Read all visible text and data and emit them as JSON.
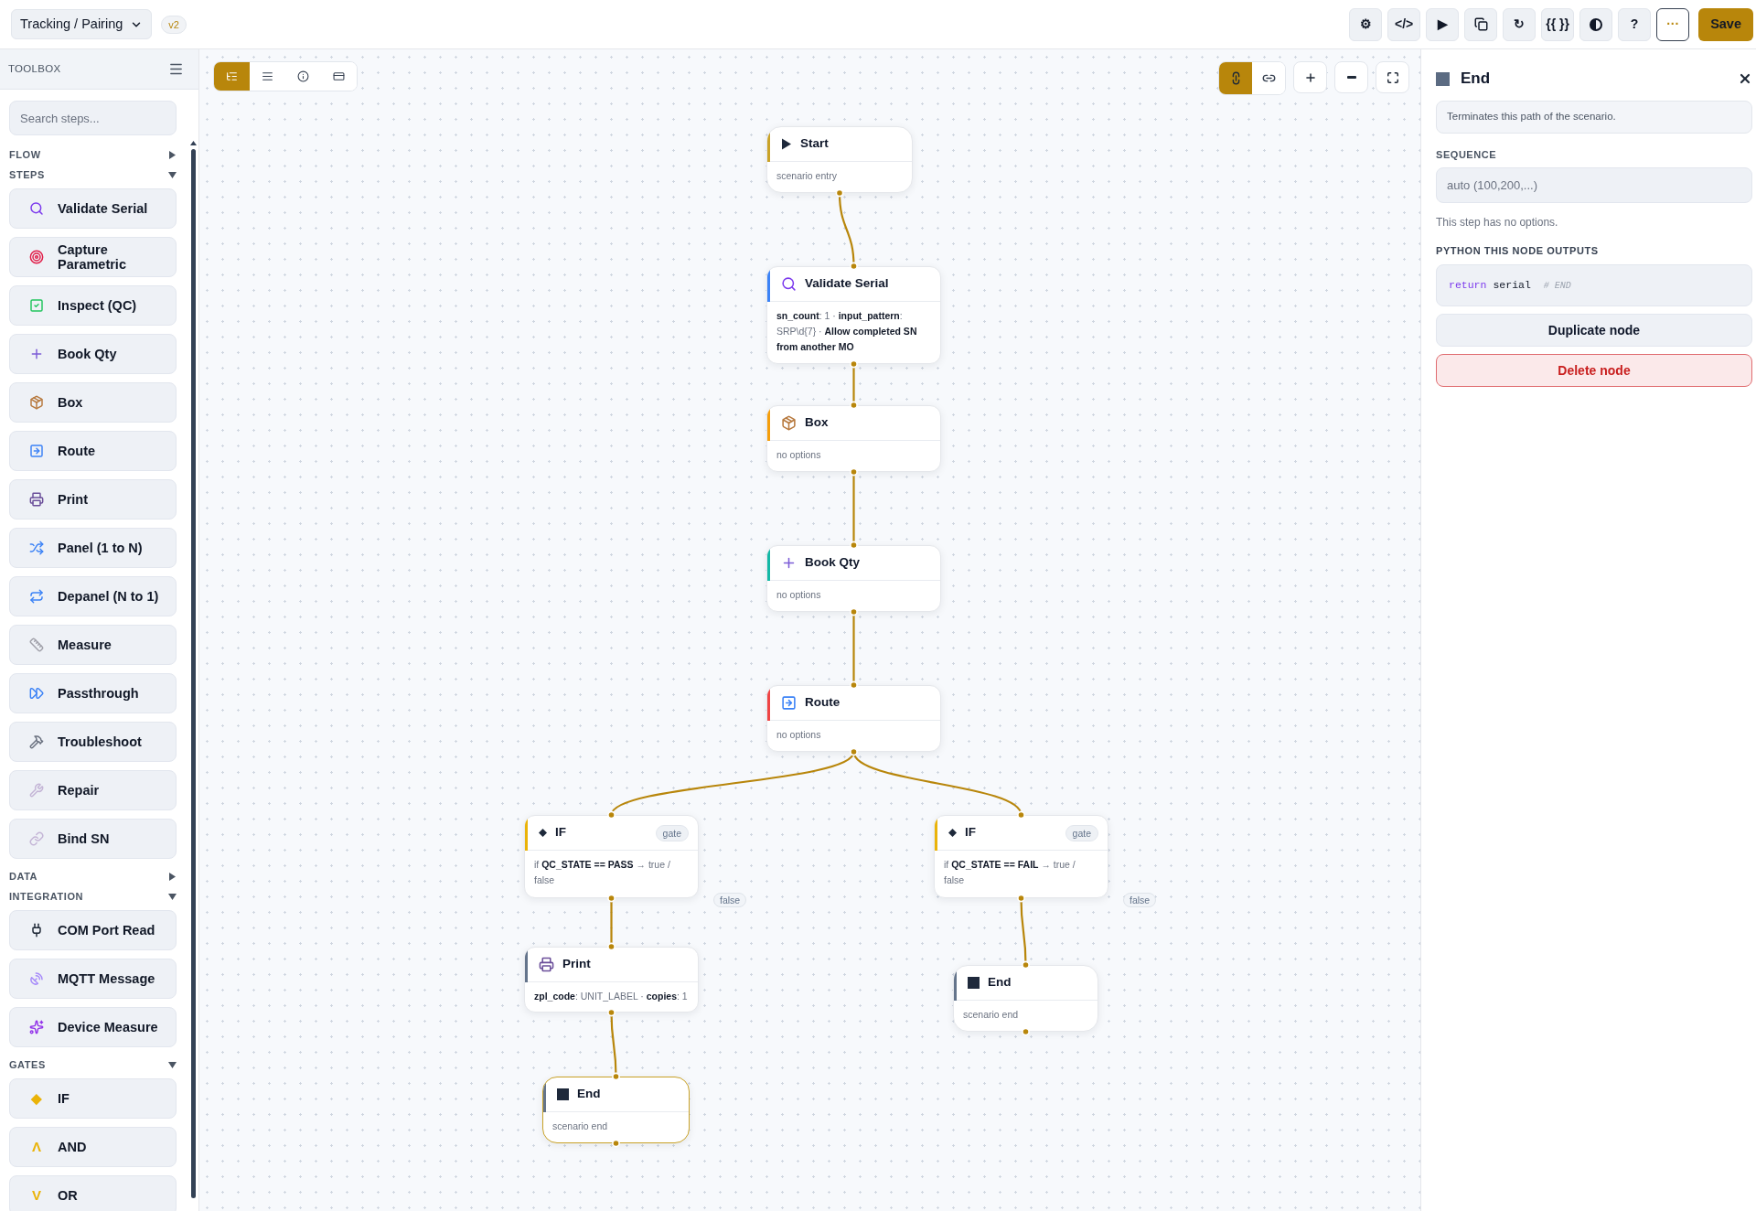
{
  "header": {
    "title": "Tracking / Pairing",
    "version": "v2",
    "tools": [
      {
        "kind": "text",
        "label": "⚙"
      },
      {
        "kind": "text",
        "label": "</>"
      },
      {
        "kind": "text",
        "label": "▶"
      },
      {
        "kind": "copy"
      },
      {
        "kind": "text",
        "label": "↻"
      },
      {
        "kind": "text",
        "label": "{{ }}"
      },
      {
        "kind": "contrast"
      },
      {
        "kind": "text",
        "label": "?"
      },
      {
        "kind": "outline",
        "label": "···"
      },
      {
        "kind": "primary",
        "label": "Save"
      }
    ]
  },
  "toolbox": {
    "title": "TOOLBOX",
    "search": {
      "placeholder": "Search steps..."
    },
    "sections": [
      {
        "title": "FLOW",
        "expanded": false
      },
      {
        "title": "STEPS",
        "expanded": true,
        "items": [
          {
            "label": "Validate Serial",
            "kind": "search"
          },
          {
            "label": "Capture Parametric",
            "kind": "target"
          },
          {
            "label": "Inspect (QC)",
            "kind": "check"
          },
          {
            "label": "Book Qty",
            "kind": "plus"
          },
          {
            "label": "Box",
            "kind": "box"
          },
          {
            "label": "Route",
            "kind": "arrow"
          },
          {
            "label": "Print",
            "kind": "print"
          },
          {
            "label": "Panel (1 to N)",
            "kind": "shuffle"
          },
          {
            "label": "Depanel (N to 1)",
            "kind": "repeat"
          },
          {
            "label": "Measure",
            "kind": "ruler"
          },
          {
            "label": "Passthrough",
            "kind": "skip"
          },
          {
            "label": "Troubleshoot",
            "kind": "tools"
          },
          {
            "label": "Repair",
            "kind": "wrench"
          },
          {
            "label": "Bind SN",
            "kind": "link"
          }
        ]
      },
      {
        "title": "DATA",
        "expanded": false
      },
      {
        "title": "INTEGRATION",
        "expanded": true,
        "items": [
          {
            "label": "COM Port Read",
            "kind": "plug"
          },
          {
            "label": "MQTT Message",
            "kind": "dish"
          },
          {
            "label": "Device Measure",
            "kind": "splat"
          }
        ]
      },
      {
        "title": "GATES",
        "expanded": true,
        "items": [
          {
            "label": "IF",
            "kind": "gate",
            "glyph": "◆"
          },
          {
            "label": "AND",
            "kind": "gate",
            "glyph": "Λ"
          },
          {
            "label": "OR",
            "kind": "gate",
            "glyph": "V"
          }
        ]
      }
    ]
  },
  "canvas_toolbar": {
    "views": [
      {
        "selected": true
      },
      {
        "selected": false
      },
      {
        "selected": false
      },
      {
        "selected": false
      }
    ],
    "layouts": [
      {
        "selected": true
      },
      {
        "selected": false
      }
    ]
  },
  "nodes": [
    {
      "title": "Start",
      "kind": "start",
      "color": "#c9a227",
      "body": "scenario entry",
      "selected": false,
      "children": [
        {
          "title": "Validate Serial",
          "kind": "search",
          "color": "#3b82f6",
          "body": "**sn_count**: 1 · **input_pattern**: SRP\\d{7} · **Allow completed SN from another MO**",
          "selected": false,
          "children": [
            {
              "title": "Box",
              "kind": "box",
              "color": "#f59e0b",
              "body": "no options",
              "selected": false,
              "children": [
                {
                  "title": "Book Qty",
                  "kind": "plus",
                  "color": "#14b8a6",
                  "body": "no options",
                  "selected": false,
                  "children": [
                    {
                      "title": "Route",
                      "kind": "arrow",
                      "color": "#ef4444",
                      "body": "no options",
                      "selected": false,
                      "children": [
                        {
                          "title": "IF",
                          "kind": "gate",
                          "color": "#eab308",
                          "badge": "gate",
                          "false_label": "false",
                          "body": "if **QC_STATE == PASS** → true / false",
                          "selected": false,
                          "children": [
                            {
                              "title": "Print",
                              "kind": "print",
                              "color": "#64748b",
                              "body": "**zpl_code**: UNIT_LABEL · **copies**: 1",
                              "selected": false,
                              "children": [
                                {
                                  "title": "End",
                                  "kind": "end",
                                  "color": "#64748b",
                                  "body": "scenario end",
                                  "selected": true
                                }
                              ]
                            }
                          ]
                        },
                        {
                          "title": "IF",
                          "kind": "gate",
                          "color": "#eab308",
                          "badge": "gate",
                          "false_label": "false",
                          "body": "if **QC_STATE == FAIL** → true / false",
                          "selected": false,
                          "children": [
                            {
                              "title": "End",
                              "kind": "end",
                              "color": "#64748b",
                              "body": "scenario end",
                              "selected": false
                            }
                          ]
                        }
                      ]
                    }
                  ]
                }
              ]
            }
          ]
        }
      ]
    }
  ],
  "inspector": {
    "title": "End",
    "description": "Terminates this path of the scenario.",
    "sequence_label": "SEQUENCE",
    "sequence": {
      "placeholder": "auto (100,200,...)"
    },
    "note": "This step has no options.",
    "code_label": "PYTHON THIS NODE OUTPUTS",
    "code": {
      "keyword": "return",
      "text": "serial",
      "comment": "# END"
    },
    "actions": [
      {
        "kind": "default",
        "label": "Duplicate node"
      },
      {
        "kind": "danger",
        "label": "Delete node"
      }
    ]
  }
}
